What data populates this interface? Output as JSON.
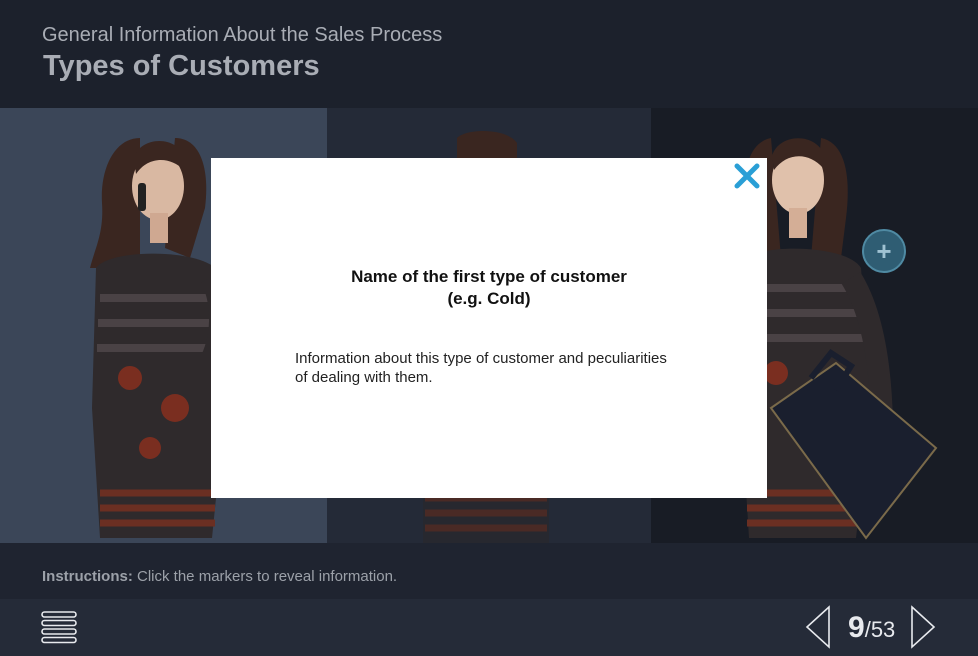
{
  "header": {
    "subtitle": "General Information About the Sales Process",
    "title": "Types of Customers"
  },
  "modal": {
    "heading_line1": "Name of the first type of customer",
    "heading_line2": "(e.g. Cold)",
    "body_line1": "Information about this type of customer and peculiarities",
    "body_line2": "of dealing with them.",
    "close_icon": "close-icon",
    "close_color": "#2a9fd6"
  },
  "marker": {
    "symbol": "+",
    "icon": "plus-icon"
  },
  "instructions": {
    "label": "Instructions:",
    "text": " Click the markers to reveal information."
  },
  "footer": {
    "menu_icon": "hamburger-menu-icon",
    "page_current": "9",
    "page_separator": "/",
    "page_total": "53",
    "prev_icon": "chevron-left-icon",
    "next_icon": "chevron-right-icon"
  }
}
